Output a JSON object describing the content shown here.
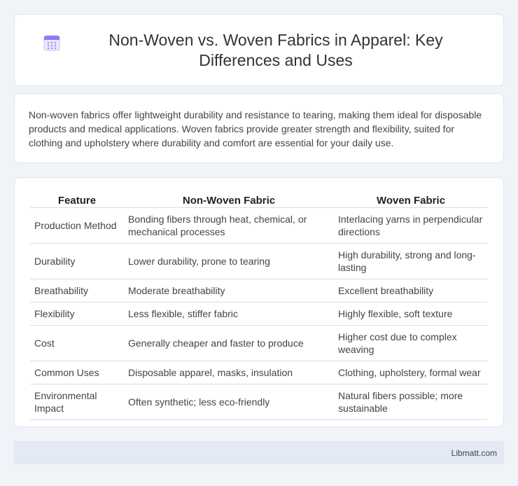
{
  "header": {
    "icon": "calendar-icon",
    "title": "Non-Woven vs. Woven Fabrics in Apparel: Key Differences and Uses"
  },
  "intro": {
    "text": "Non-woven fabrics offer lightweight durability and resistance to tearing, making them ideal for disposable products and medical applications. Woven fabrics provide greater strength and flexibility, suited for clothing and upholstery where durability and comfort are essential for your daily use."
  },
  "table": {
    "headers": [
      "Feature",
      "Non-Woven Fabric",
      "Woven Fabric"
    ],
    "rows": [
      [
        "Production Method",
        "Bonding fibers through heat, chemical, or mechanical processes",
        "Interlacing yarns in perpendicular directions"
      ],
      [
        "Durability",
        "Lower durability, prone to tearing",
        "High durability, strong and long-lasting"
      ],
      [
        "Breathability",
        "Moderate breathability",
        "Excellent breathability"
      ],
      [
        "Flexibility",
        "Less flexible, stiffer fabric",
        "Highly flexible, soft texture"
      ],
      [
        "Cost",
        "Generally cheaper and faster to produce",
        "Higher cost due to complex weaving"
      ],
      [
        "Common Uses",
        "Disposable apparel, masks, insulation",
        "Clothing, upholstery, formal wear"
      ],
      [
        "Environmental Impact",
        "Often synthetic; less eco-friendly",
        "Natural fibers possible; more sustainable"
      ]
    ]
  },
  "footer": {
    "text": "Libmatt.com"
  }
}
